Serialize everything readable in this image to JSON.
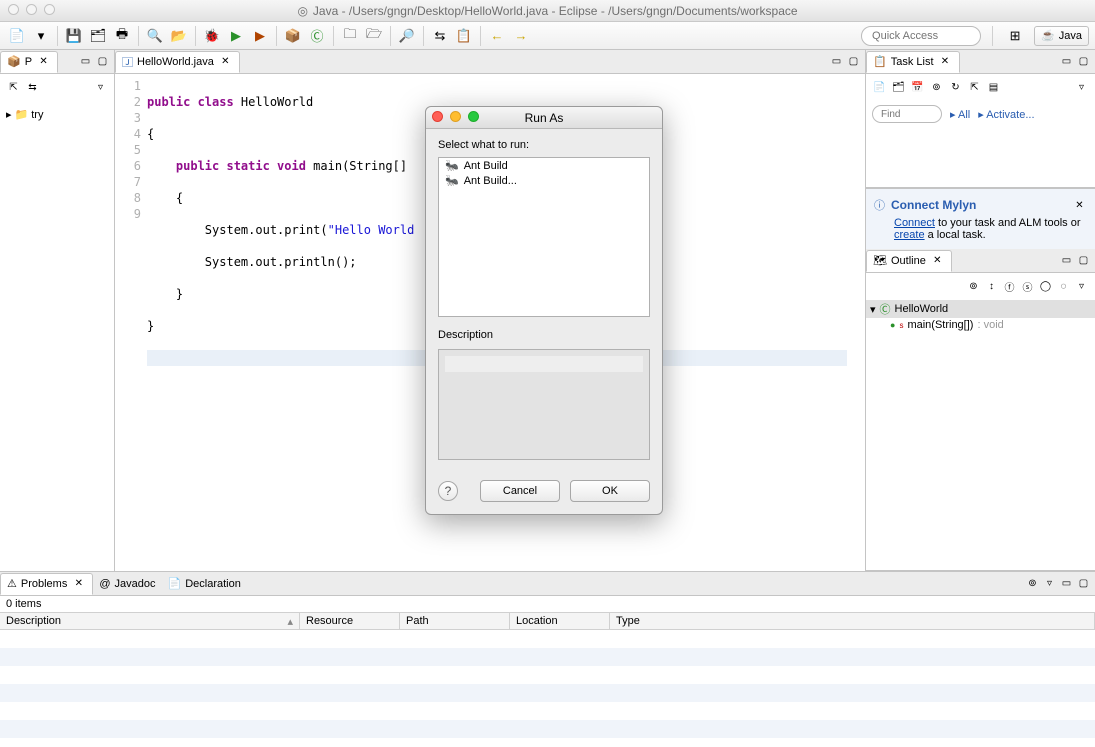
{
  "window": {
    "title": "Java - /Users/gngn/Desktop/HelloWorld.java - Eclipse - /Users/gngn/Documents/workspace"
  },
  "quick_access": {
    "placeholder": "Quick Access"
  },
  "perspective": {
    "name": "Java"
  },
  "package_explorer": {
    "tab": "P",
    "project": "try"
  },
  "editor": {
    "tab": "HelloWorld.java",
    "lines": [
      {
        "n": "1",
        "pre": "",
        "kw": "public class",
        "mid": " HelloWorld"
      },
      {
        "n": "2",
        "raw": "{"
      },
      {
        "n": "3",
        "pre": "    ",
        "kw": "public static void",
        "mid": " main(String[] "
      },
      {
        "n": "4",
        "raw": "    {"
      },
      {
        "n": "5",
        "pre": "        ",
        "call": "System.out.print(",
        "str": "\"Hello World",
        "tail": ""
      },
      {
        "n": "6",
        "raw": "        System.out.println();"
      },
      {
        "n": "7",
        "raw": "    }"
      },
      {
        "n": "8",
        "raw": "}"
      },
      {
        "n": "9",
        "raw": ""
      }
    ]
  },
  "dialog": {
    "title": "Run As",
    "prompt": "Select what to run:",
    "options": [
      "Ant Build",
      "Ant Build..."
    ],
    "desc_label": "Description",
    "cancel": "Cancel",
    "ok": "OK"
  },
  "tasklist": {
    "title": "Task List",
    "find_placeholder": "Find",
    "all": "All",
    "activate": "Activate..."
  },
  "mylyn": {
    "title": "Connect Mylyn",
    "connect": "Connect",
    "connect_tail": " to your task and ALM tools or ",
    "create": "create",
    "create_tail": " a local task."
  },
  "outline": {
    "title": "Outline",
    "class": "HelloWorld",
    "method": "main(String[]) ",
    "ret": ": void"
  },
  "problems": {
    "tabs": [
      "Problems",
      "Javadoc",
      "Declaration"
    ],
    "items": "0 items",
    "cols": [
      "Description",
      "Resource",
      "Path",
      "Location",
      "Type"
    ]
  }
}
